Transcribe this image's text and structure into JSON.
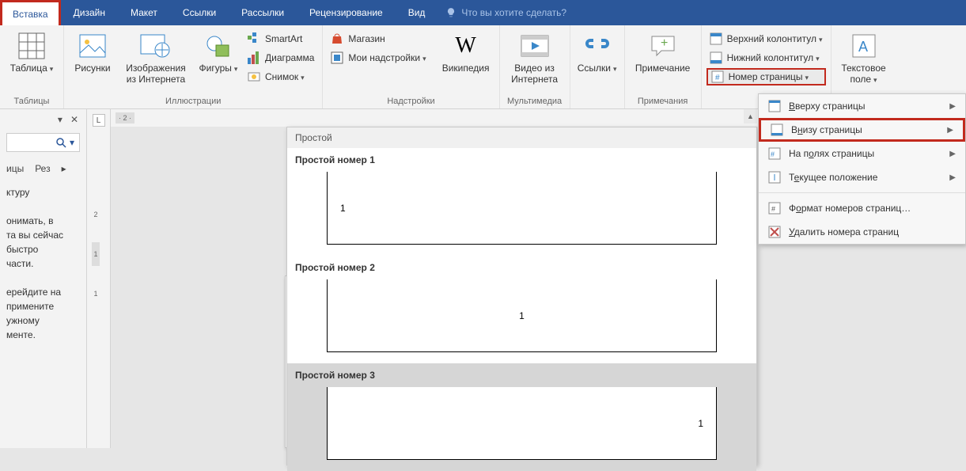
{
  "tabs": {
    "items": [
      "Вставка",
      "Дизайн",
      "Макет",
      "Ссылки",
      "Рассылки",
      "Рецензирование",
      "Вид"
    ],
    "active": "Вставка",
    "tellme": "Что вы хотите сделать?"
  },
  "ribbon": {
    "tables": {
      "label": "Таблицы",
      "table": "Таблица"
    },
    "illustrations": {
      "label": "Иллюстрации",
      "pictures": "Рисунки",
      "online": "Изображения\nиз Интернета",
      "shapes": "Фигуры",
      "smartart": "SmartArt",
      "chart": "Диаграмма",
      "screenshot": "Снимок"
    },
    "addins": {
      "label": "Надстройки",
      "store": "Магазин",
      "myaddins": "Мои надстройки",
      "wikipedia": "Википедия"
    },
    "media": {
      "label": "Мультимедиа",
      "video": "Видео из\nИнтернета"
    },
    "links": {
      "label": "",
      "links": "Ссылки"
    },
    "comments": {
      "label": "Примечания",
      "comment": "Примечание"
    },
    "header": {
      "label": "",
      "header": "Верхний колонтитул",
      "footer": "Нижний колонтитул",
      "pagenum": "Номер страницы"
    },
    "text": {
      "label": "",
      "textbox": "Текстовое\nполе"
    }
  },
  "pn_menu": {
    "top": "Вверху страницы",
    "bottom": "Внизу страницы",
    "margins": "На полях страницы",
    "current": "Текущее положение",
    "format": "Формат номеров страниц…",
    "remove": "Удалить номера страниц",
    "u": {
      "top": "В",
      "bottom": "н",
      "margins": "о",
      "current": "е",
      "format": "о",
      "remove": "У"
    }
  },
  "gallery": {
    "head": "Простой",
    "items": [
      {
        "title": "Простой номер 1",
        "num": "1",
        "align": "left"
      },
      {
        "title": "Простой номер 2",
        "num": "1",
        "align": "center"
      },
      {
        "title": "Простой номер 3",
        "num": "1",
        "align": "right",
        "selected": true
      }
    ]
  },
  "nav": {
    "tab1": "ицы",
    "tab2": "Рез",
    "line1": "ктуру",
    "para": "онимать, в\nта вы сейчас\nбыстро\nчасти.",
    "para2": "ерейдите на\nпримените\nужному\nменте."
  },
  "ruler": {
    "h": "· 2 ·",
    "v": [
      "2",
      "1",
      "1"
    ]
  }
}
